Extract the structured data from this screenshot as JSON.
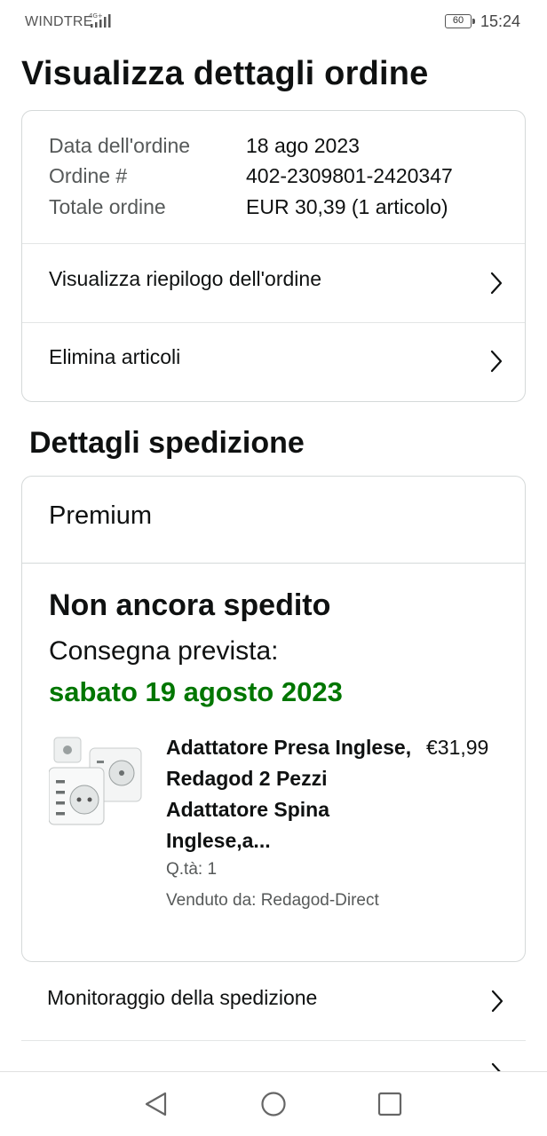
{
  "status_bar": {
    "carrier": "WINDTRE",
    "network": "4G+",
    "battery": "60",
    "time": "15:24"
  },
  "page_title": "Visualizza dettagli ordine",
  "order": {
    "date_label": "Data dell'ordine",
    "date_value": "18 ago 2023",
    "number_label": "Ordine #",
    "number_value": "402-2309801-2420347",
    "total_label": "Totale ordine",
    "total_value": "EUR 30,39 (1 articolo)"
  },
  "order_actions": [
    {
      "label": "Visualizza riepilogo dell'ordine"
    },
    {
      "label": "Elimina articoli"
    }
  ],
  "shipping": {
    "section_title": "Dettagli spedizione",
    "type": "Premium",
    "status": "Non ancora spedito",
    "expected_label": "Consegna prevista:",
    "expected_date": "sabato 19 agosto 2023",
    "product": {
      "title": "Adattatore Presa Inglese, Redagod 2 Pezzi Adattatore Spina Inglese,a...",
      "price": "€31,99",
      "quantity": "Q.tà: 1",
      "seller": "Venduto da: Redagod-Direct"
    }
  },
  "shipping_actions": [
    {
      "label": "Monitoraggio della spedizione"
    }
  ],
  "icons": {
    "chevron": "chevron-right-icon",
    "back": "back-triangle-icon",
    "home": "home-circle-icon",
    "recents": "recents-square-icon"
  },
  "colors": {
    "delivery_green": "#007600",
    "border": "#d5d9d9",
    "secondary_text": "#565959"
  }
}
